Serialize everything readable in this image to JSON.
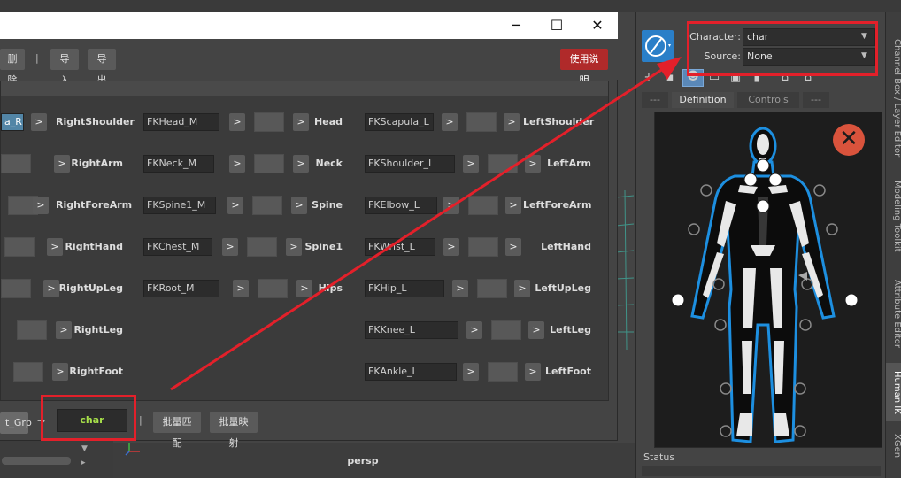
{
  "dialog": {
    "window_controls": [
      "─",
      "☐",
      "✕"
    ],
    "toolbar": {
      "delete_label": "删除",
      "separator": "|",
      "import_label": "导入",
      "export_label": "导出",
      "help_label": "使用说明"
    },
    "mapping_rows": [
      {
        "left_field": "a_R",
        "left_label": "RightShoulder",
        "mid_field": "FKHead_M",
        "mid_label": "Head",
        "right_field": "FKScapula_L",
        "right_label": "LeftShoulder"
      },
      {
        "left_field": "",
        "left_label": "RightArm",
        "mid_field": "FKNeck_M",
        "mid_label": "Neck",
        "right_field": "FKShoulder_L",
        "right_label": "LeftArm"
      },
      {
        "left_field": "",
        "left_label": "RightForeArm",
        "mid_field": "FKSpine1_M",
        "mid_label": "Spine",
        "right_field": "FKElbow_L",
        "right_label": "LeftForeArm"
      },
      {
        "left_field": "",
        "left_label": "RightHand",
        "mid_field": "FKChest_M",
        "mid_label": "Spine1",
        "right_field": "FKWrist_L",
        "right_label": "LeftHand"
      },
      {
        "left_field": "",
        "left_label": "RightUpLeg",
        "mid_field": "FKRoot_M",
        "mid_label": "Hips",
        "right_field": "FKHip_L",
        "right_label": "LeftUpLeg"
      },
      {
        "left_field": "",
        "left_label": "RightLeg",
        "mid_field": "",
        "mid_label": "",
        "right_field": "FKKnee_L",
        "right_label": "LeftLeg"
      },
      {
        "left_field": "",
        "left_label": "RightFoot",
        "mid_field": "",
        "mid_label": "",
        "right_field": "FKAnkle_L",
        "right_label": "LeftFoot"
      }
    ],
    "arrow_glyph": ">",
    "bottom": {
      "grp_field": "t_Grp",
      "arrow_text": "→",
      "char_field": "char",
      "separator": "|",
      "batch_match_label": "批量匹配",
      "batch_map_label": "批量映射"
    }
  },
  "viewport": {
    "camera_label": "persp"
  },
  "hik": {
    "character_label": "Character:",
    "character_value": "char",
    "source_label": "Source:",
    "source_value": "None",
    "tabs": [
      "---",
      "Definition",
      "Controls",
      "---"
    ],
    "active_tab": "Definition",
    "status_label": "Status",
    "close_glyph": "✕"
  },
  "side_tabs": [
    "Channel Box / Layer Editor",
    "Modeling Toolkit",
    "Attribute Editor",
    "Human IK",
    "XGen"
  ],
  "colors": {
    "accent_red": "#e3202a",
    "help_button": "#b02a2a",
    "highlight_field": "#5285a6",
    "char_text": "#a7e04a",
    "figure_blue": "#1d8fe0"
  }
}
